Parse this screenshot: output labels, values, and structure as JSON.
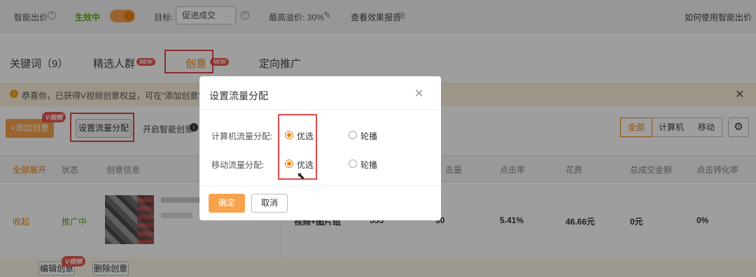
{
  "topbar": {
    "smart_bid": "智能出价",
    "status": "生效中",
    "target_label": "目标:",
    "target_value": "促进成交",
    "max_premium": "最高溢价: 30%",
    "view_report": "查看效果报告",
    "how_to_use": "如何使用智能出价"
  },
  "tabs": [
    {
      "label": "关键词（9）"
    },
    {
      "label": "精选人群",
      "badge": "NEW"
    },
    {
      "label": "创意",
      "badge": "NEW"
    },
    {
      "label": "定向推广"
    }
  ],
  "notice": {
    "text": "恭喜你，已获得V视频创意权益，可在\"添加创意\"、\""
  },
  "toolbar": {
    "add_creative": "+添加创意",
    "add_badge": "V视频",
    "set_traffic": "设置流量分配",
    "smart_creative": "开启智能创意",
    "filter": [
      "全部",
      "计算机",
      "移动"
    ],
    "filter_active": "全部"
  },
  "table": {
    "headers": [
      "全部展开",
      "状态",
      "创意信息",
      "击量",
      "点击率",
      "花费",
      "总成交金额",
      "点击转化率"
    ],
    "row": {
      "expand": "收起",
      "status": "推广中",
      "type": "视频+图片组",
      "v1": "555",
      "v2": "30",
      "ctr": "5.41%",
      "cost": "46.66元",
      "gmv": "0元",
      "cvr": "0%",
      "edit": "编辑创意",
      "edit_badge": "V视频",
      "delete": "删除创意"
    }
  },
  "dialog": {
    "title": "设置流量分配",
    "pc_label": "计算机流量分配:",
    "mobile_label": "移动流量分配:",
    "opt_preferred": "优选",
    "opt_rotate": "轮播",
    "pc_selected": "优选",
    "mobile_selected": "优选",
    "confirm": "确定",
    "cancel": "取消"
  },
  "colors": {
    "accent": "#f0800e",
    "highlight": "#e0484a",
    "status_green": "#6aa51e"
  }
}
